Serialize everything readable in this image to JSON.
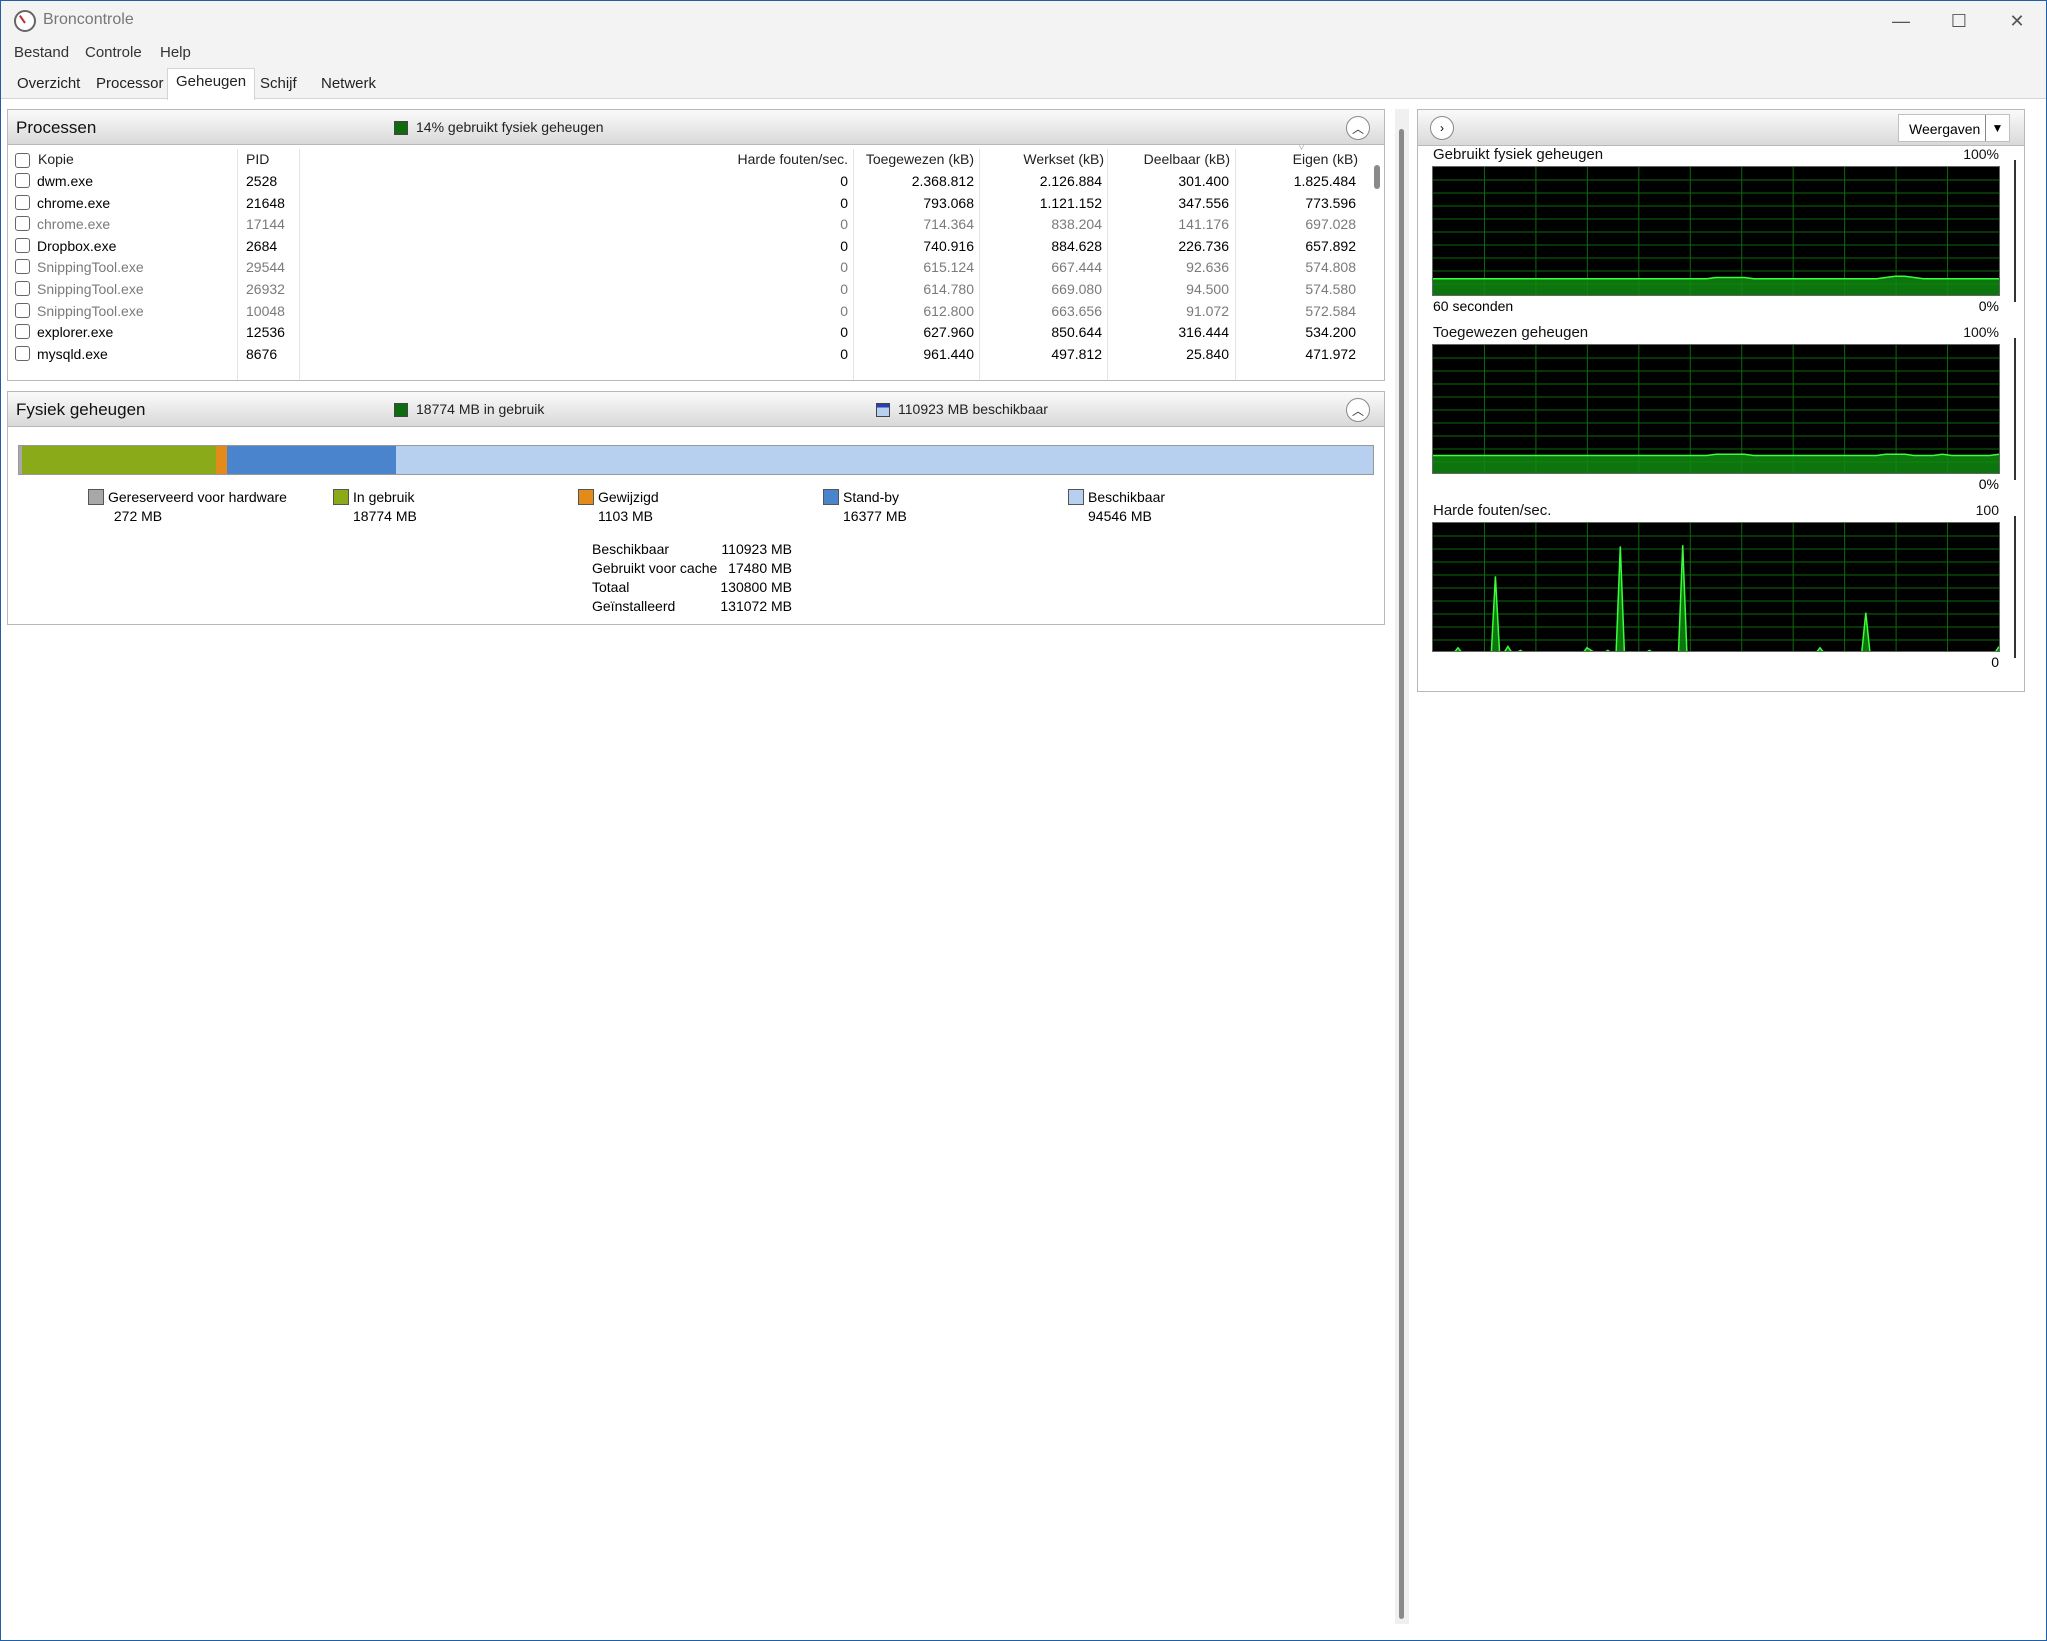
{
  "window": {
    "title": "Broncontrole",
    "minimize": "—",
    "maximize": "☐",
    "close": "✕"
  },
  "menu": {
    "items": [
      "Bestand",
      "Controle",
      "Help"
    ]
  },
  "tabs": [
    "Overzicht",
    "Processor",
    "Geheugen",
    "Schijf",
    "Netwerk"
  ],
  "active_tab": "Geheugen",
  "processes": {
    "title": "Processen",
    "status": "14% gebruikt fysiek geheugen",
    "status_color": "#0f6b0f",
    "columns": [
      "Kopie",
      "PID",
      "Harde fouten/sec.",
      "Toegewezen (kB)",
      "Werkset (kB)",
      "Deelbaar (kB)",
      "Eigen (kB)"
    ],
    "rows": [
      {
        "name": "dwm.exe",
        "pid": "2528",
        "faults": "0",
        "commit": "2.368.812",
        "working": "2.126.884",
        "shareable": "301.400",
        "private": "1.825.484",
        "dim": false
      },
      {
        "name": "chrome.exe",
        "pid": "21648",
        "faults": "0",
        "commit": "793.068",
        "working": "1.121.152",
        "shareable": "347.556",
        "private": "773.596",
        "dim": false
      },
      {
        "name": "chrome.exe",
        "pid": "17144",
        "faults": "0",
        "commit": "714.364",
        "working": "838.204",
        "shareable": "141.176",
        "private": "697.028",
        "dim": true
      },
      {
        "name": "Dropbox.exe",
        "pid": "2684",
        "faults": "0",
        "commit": "740.916",
        "working": "884.628",
        "shareable": "226.736",
        "private": "657.892",
        "dim": false
      },
      {
        "name": "SnippingTool.exe",
        "pid": "29544",
        "faults": "0",
        "commit": "615.124",
        "working": "667.444",
        "shareable": "92.636",
        "private": "574.808",
        "dim": true
      },
      {
        "name": "SnippingTool.exe",
        "pid": "26932",
        "faults": "0",
        "commit": "614.780",
        "working": "669.080",
        "shareable": "94.500",
        "private": "574.580",
        "dim": true
      },
      {
        "name": "SnippingTool.exe",
        "pid": "10048",
        "faults": "0",
        "commit": "612.800",
        "working": "663.656",
        "shareable": "91.072",
        "private": "572.584",
        "dim": true
      },
      {
        "name": "explorer.exe",
        "pid": "12536",
        "faults": "0",
        "commit": "627.960",
        "working": "850.644",
        "shareable": "316.444",
        "private": "534.200",
        "dim": false
      },
      {
        "name": "mysqld.exe",
        "pid": "8676",
        "faults": "0",
        "commit": "961.440",
        "working": "497.812",
        "shareable": "25.840",
        "private": "471.972",
        "dim": false
      }
    ]
  },
  "physical": {
    "title": "Fysiek geheugen",
    "in_use": "18774 MB in gebruik",
    "available": "110923 MB beschikbaar",
    "bar": [
      {
        "key": "reserved",
        "mb": 272,
        "color": "#a8a8a8"
      },
      {
        "key": "inuse",
        "mb": 18774,
        "color": "#8aaa1a"
      },
      {
        "key": "modified",
        "mb": 1103,
        "color": "#e28a1a"
      },
      {
        "key": "standby",
        "mb": 16377,
        "color": "#4a84cc"
      },
      {
        "key": "free",
        "mb": 94546,
        "color": "#b7d0ef"
      }
    ],
    "legend": [
      {
        "label": "Gereserveerd voor hardware",
        "value": "272 MB",
        "color": "#a8a8a8"
      },
      {
        "label": "In gebruik",
        "value": "18774 MB",
        "color": "#8aaa1a"
      },
      {
        "label": "Gewijzigd",
        "value": "1103 MB",
        "color": "#e28a1a"
      },
      {
        "label": "Stand-by",
        "value": "16377 MB",
        "color": "#4a84cc"
      },
      {
        "label": "Beschikbaar",
        "value": "94546 MB",
        "color": "#b7d0ef"
      }
    ],
    "summary": [
      {
        "key": "Beschikbaar",
        "value": "110923 MB"
      },
      {
        "key": "Gebruikt voor cache",
        "value": "17480 MB"
      },
      {
        "key": "Totaal",
        "value": "130800 MB"
      },
      {
        "key": "Geïnstalleerd",
        "value": "131072 MB"
      }
    ]
  },
  "right": {
    "views_label": "Weergaven",
    "graphs": [
      {
        "title": "Gebruikt fysiek geheugen",
        "max": "100%",
        "min": "0%",
        "foot_left": "60 seconden",
        "series": [
          14,
          14,
          14,
          14,
          14,
          14,
          14,
          14,
          14,
          14,
          14,
          14,
          14,
          14,
          14,
          14,
          14,
          14,
          14,
          14,
          14,
          14,
          14,
          14,
          14,
          14,
          14,
          14,
          14,
          14,
          15,
          15,
          15,
          15,
          14,
          14,
          14,
          14,
          14,
          14,
          14,
          14,
          14,
          14,
          14,
          14,
          14,
          14,
          15,
          16,
          16,
          15,
          14,
          14,
          14,
          14,
          14,
          14,
          14,
          14,
          14
        ]
      },
      {
        "title": "Toegewezen geheugen",
        "max": "100%",
        "min": "0%",
        "foot_left": "",
        "series": [
          15,
          15,
          15,
          15,
          15,
          15,
          15,
          15,
          15,
          15,
          15,
          15,
          15,
          15,
          15,
          15,
          15,
          15,
          15,
          15,
          15,
          15,
          15,
          15,
          15,
          15,
          15,
          15,
          15,
          15,
          16,
          16,
          16,
          16,
          15,
          15,
          15,
          15,
          15,
          15,
          15,
          15,
          15,
          15,
          15,
          15,
          15,
          15,
          16,
          16,
          16,
          15,
          15,
          15,
          16,
          15,
          15,
          15,
          15,
          15,
          16
        ]
      },
      {
        "title": "Harde fouten/sec.",
        "max": "100",
        "min": "0",
        "foot_left": "",
        "series": [
          0,
          0,
          0,
          0,
          0,
          0,
          4,
          0,
          0,
          0,
          0,
          0,
          0,
          0,
          0,
          59,
          0,
          0,
          5,
          0,
          0,
          2,
          0,
          0,
          0,
          0,
          0,
          0,
          0,
          0,
          0,
          0,
          0,
          0,
          0,
          0,
          0,
          4,
          2,
          0,
          0,
          0,
          2,
          0,
          0,
          82,
          0,
          0,
          0,
          0,
          0,
          0,
          2,
          0,
          0,
          0,
          0,
          0,
          0,
          0,
          83,
          0,
          0,
          0,
          0,
          0,
          0,
          0,
          0,
          0,
          0,
          0,
          0,
          0,
          0,
          0,
          0,
          0,
          0,
          0,
          0,
          0,
          0,
          0,
          0,
          0,
          0,
          0,
          0,
          0,
          0,
          0,
          0,
          4,
          0,
          0,
          0,
          0,
          0,
          0,
          0,
          0,
          0,
          0,
          31,
          0,
          0,
          0,
          0,
          0,
          0,
          0,
          0,
          0,
          0,
          0,
          0,
          0,
          0,
          0,
          0,
          0,
          0,
          0,
          0,
          0,
          0,
          0,
          0,
          0,
          0,
          0,
          0,
          0,
          0,
          0,
          5
        ]
      }
    ]
  }
}
